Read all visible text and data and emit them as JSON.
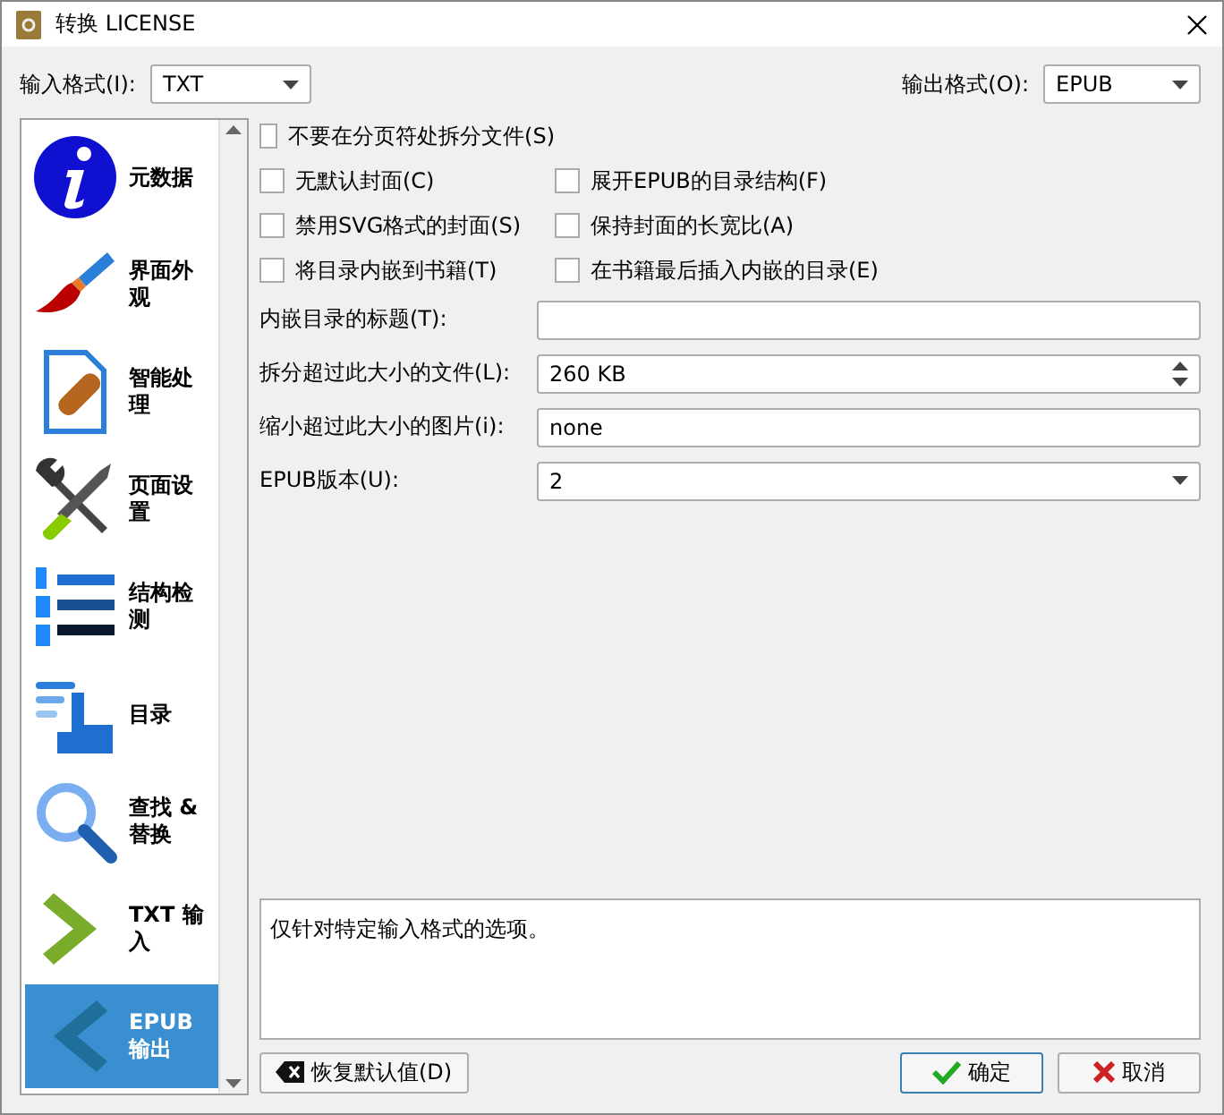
{
  "window": {
    "title": "转换 LICENSE"
  },
  "input_format": {
    "label": "输入格式(I):",
    "value": "TXT"
  },
  "output_format": {
    "label": "输出格式(O):",
    "value": "EPUB"
  },
  "sidebar": {
    "items": [
      {
        "label": "元数据",
        "selected": false
      },
      {
        "label": "界面外观",
        "selected": false
      },
      {
        "label": "智能处理",
        "selected": false
      },
      {
        "label": "页面设置",
        "selected": false
      },
      {
        "label": "结构检测",
        "selected": false
      },
      {
        "label": "目录",
        "selected": false
      },
      {
        "label": "查找 & 替换",
        "selected": false
      },
      {
        "label": "TXT 输入",
        "selected": false
      },
      {
        "label": "EPUB 输出",
        "selected": true
      }
    ]
  },
  "checkbox_rows": [
    [
      {
        "label": "不要在分页符处拆分文件(S)",
        "checked": false
      }
    ],
    [
      {
        "label": "无默认封面(C)",
        "checked": false
      },
      {
        "label": "展开EPUB的目录结构(F)",
        "checked": false
      }
    ],
    [
      {
        "label": "禁用SVG格式的封面(S)",
        "checked": false
      },
      {
        "label": "保持封面的长宽比(A)",
        "checked": false
      }
    ],
    [
      {
        "label": "将目录内嵌到书籍(T)",
        "checked": false
      },
      {
        "label": "在书籍最后插入内嵌的目录(E)",
        "checked": false
      }
    ]
  ],
  "fields": [
    {
      "kind": "text",
      "label": "内嵌目录的标题(T):"
    },
    {
      "kind": "spin",
      "label": "拆分超过此大小的文件(L):",
      "value": "260 KB"
    },
    {
      "kind": "text",
      "label": "缩小超过此大小的图片(i):",
      "value": "none"
    },
    {
      "kind": "combo",
      "label": "EPUB版本(U):",
      "value": "2"
    }
  ],
  "description": "仅针对特定输入格式的选项。",
  "buttons": {
    "restore": "恢复默认值(D)",
    "ok": "确定",
    "cancel": "取消"
  }
}
